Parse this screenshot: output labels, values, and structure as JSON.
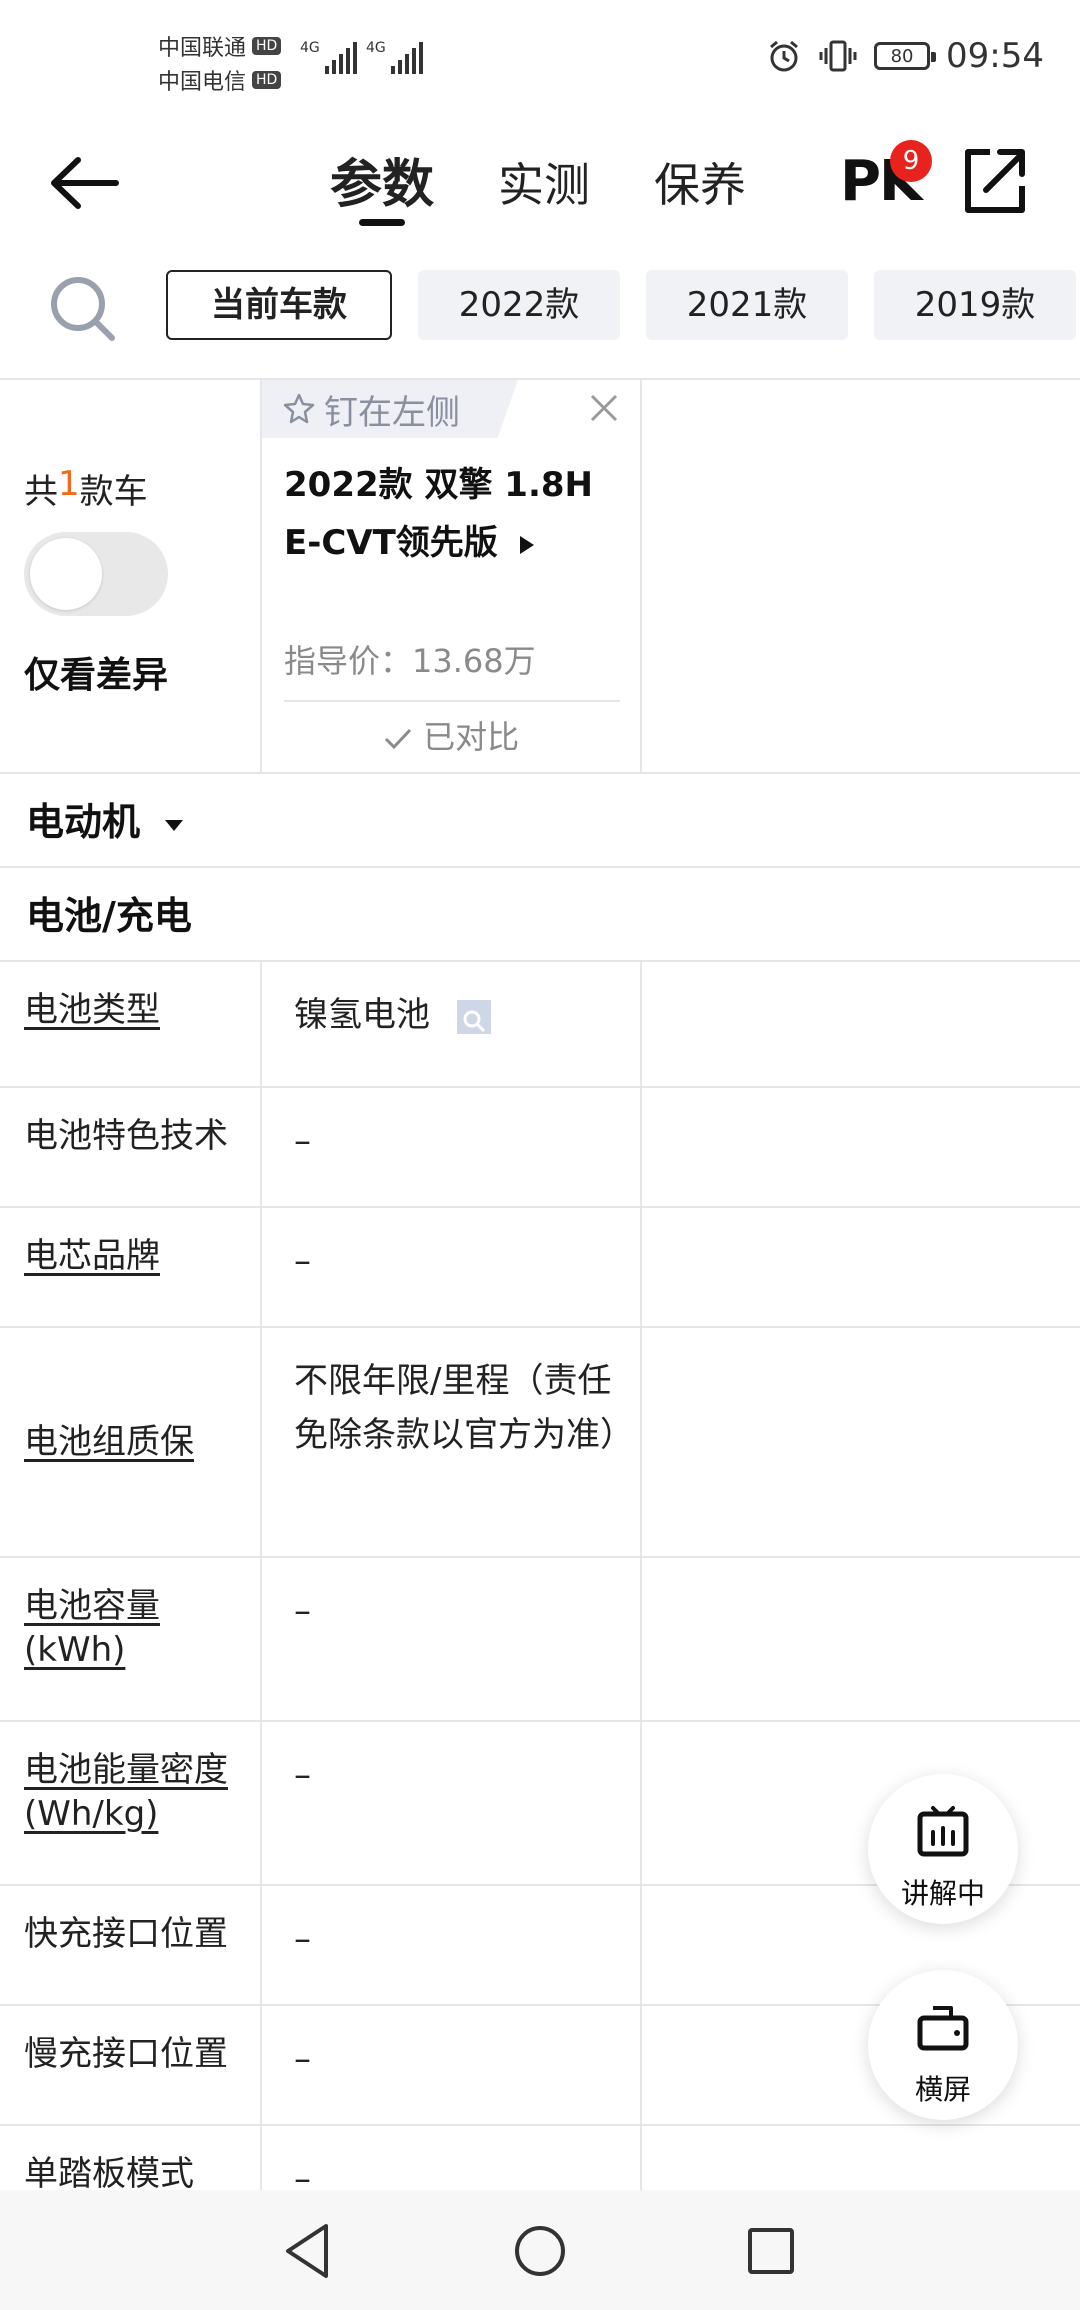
{
  "status": {
    "carrier1": "中国联通",
    "carrier2": "中国电信",
    "hd": "HD",
    "net": "4G",
    "battery": "80",
    "time": "09:54"
  },
  "nav": {
    "tabs": [
      "参数",
      "实测",
      "保养"
    ],
    "pk": "PK",
    "pk_badge": "9"
  },
  "years": [
    "当前车款",
    "2022款",
    "2021款",
    "2019款"
  ],
  "header": {
    "count_prefix": "共",
    "count_num": "1",
    "count_suffix": "款车",
    "diff_label": "仅看差异",
    "pin_label": "钉在左侧",
    "car_name": "2022款 双擎 1.8H E-CVT领先版",
    "price": "指导价：13.68万",
    "compared": "已对比"
  },
  "sections": {
    "motor": "电动机",
    "battery": "电池/充电"
  },
  "params": [
    {
      "name": "电池类型",
      "value": "镍氢电池"
    },
    {
      "name": "电池特色技术",
      "value": "–"
    },
    {
      "name": "电芯品牌",
      "value": "–"
    },
    {
      "name": "电池组质保",
      "value": "不限年限/里程（责任免除条款以官方为准）"
    },
    {
      "name": "电池容量(kWh)",
      "value": "–"
    },
    {
      "name": "电池能量密度(Wh/kg)",
      "value": "–"
    },
    {
      "name": "快充接口位置",
      "value": "–"
    },
    {
      "name": "慢充接口位置",
      "value": "–"
    },
    {
      "name": "单踏板模式",
      "value": "–"
    }
  ],
  "fab": {
    "explain": "讲解中",
    "landscape": "横屏"
  },
  "icons": {
    "back": "back-arrow-icon",
    "share": "share-icon",
    "search": "search-icon",
    "pin": "pin-icon",
    "close": "close-icon",
    "explain": "tv-icon",
    "landscape": "rotate-screen-icon"
  }
}
